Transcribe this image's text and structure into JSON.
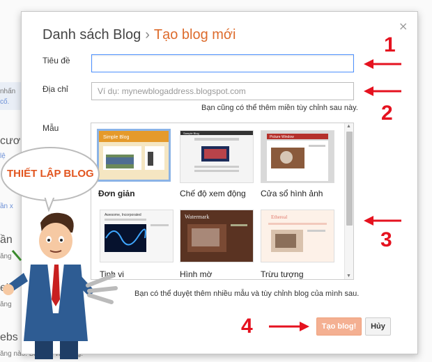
{
  "background_page": {
    "fragments": [
      "nhấn",
      "cố.",
      "cươ",
      "lệ",
      "ần x",
      "ần",
      "ăng",
      "e'",
      "ăng",
      "ebs",
      "ăng nào. Bắt đầu viết blog."
    ]
  },
  "dialog": {
    "breadcrumb_root": "Danh sách Blog",
    "breadcrumb_separator": "›",
    "breadcrumb_current": "Tạo blog mới",
    "close_symbol": "×",
    "title_label": "Tiêu đề",
    "title_value": "",
    "address_label": "Địa chỉ",
    "address_placeholder": "Ví dụ: mynewblogaddress.blogspot.com",
    "address_hint": "Bạn cũng có thể thêm miền tùy chỉnh sau này.",
    "template_label": "Mẫu",
    "templates": [
      {
        "name": "Đơn giản",
        "selected": true,
        "header_text": "Simple Blog"
      },
      {
        "name": "Chế độ xem động",
        "selected": false,
        "header_text": "Sample Blog"
      },
      {
        "name": "Cửa sổ hình ảnh",
        "selected": false,
        "header_text": "Picture Window"
      },
      {
        "name": "Tinh vi",
        "selected": false,
        "header_text": "Awesome, Incorporated"
      },
      {
        "name": "Hình mờ",
        "selected": false,
        "header_text": "Watermark"
      },
      {
        "name": "Trừu tượng",
        "selected": false,
        "header_text": "Ethereal"
      }
    ],
    "templates_hint": "Bạn có thể duyệt thêm nhiều mẫu và tùy chỉnh blog của mình sau.",
    "create_button": "Tạo blog!",
    "cancel_button": "Hủy"
  },
  "annotations": {
    "numbers": [
      "1",
      "2",
      "3",
      "4"
    ],
    "bubble_text": "THIẾT LẬP BLOG",
    "arrow_color": "#e5121f"
  },
  "colors": {
    "accent_orange": "#dd6b2c",
    "focus_blue": "#4d90fe",
    "create_button_bg": "#f4b092"
  }
}
